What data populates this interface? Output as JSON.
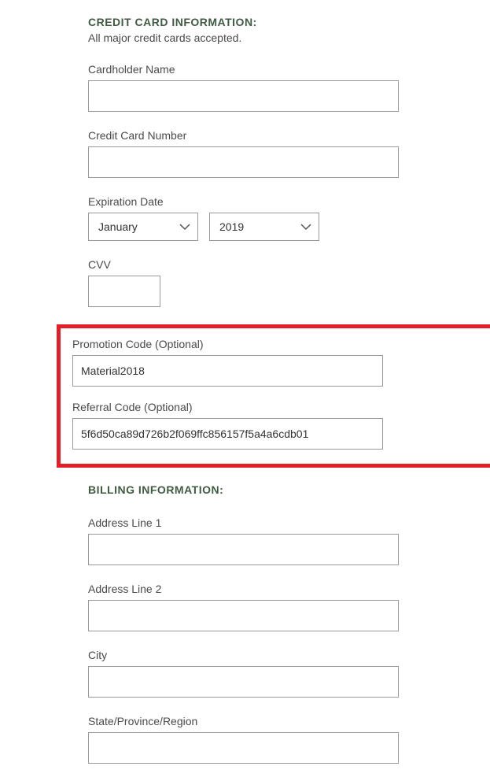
{
  "creditCard": {
    "heading": "CREDIT CARD INFORMATION:",
    "subtext": "All major credit cards accepted.",
    "cardholderName": {
      "label": "Cardholder Name",
      "value": ""
    },
    "cardNumber": {
      "label": "Credit Card Number",
      "value": ""
    },
    "expiration": {
      "label": "Expiration Date",
      "month": "January",
      "year": "2019"
    },
    "cvv": {
      "label": "CVV",
      "value": ""
    },
    "promoCode": {
      "label": "Promotion Code (Optional)",
      "value": "Material2018"
    },
    "referralCode": {
      "label": "Referral Code (Optional)",
      "value": "5f6d50ca89d726b2f069ffc856157f5a4a6cdb01"
    }
  },
  "billing": {
    "heading": "BILLING INFORMATION:",
    "address1": {
      "label": "Address Line 1",
      "value": ""
    },
    "address2": {
      "label": "Address Line 2",
      "value": ""
    },
    "city": {
      "label": "City",
      "value": ""
    },
    "state": {
      "label": "State/Province/Region",
      "value": ""
    }
  }
}
